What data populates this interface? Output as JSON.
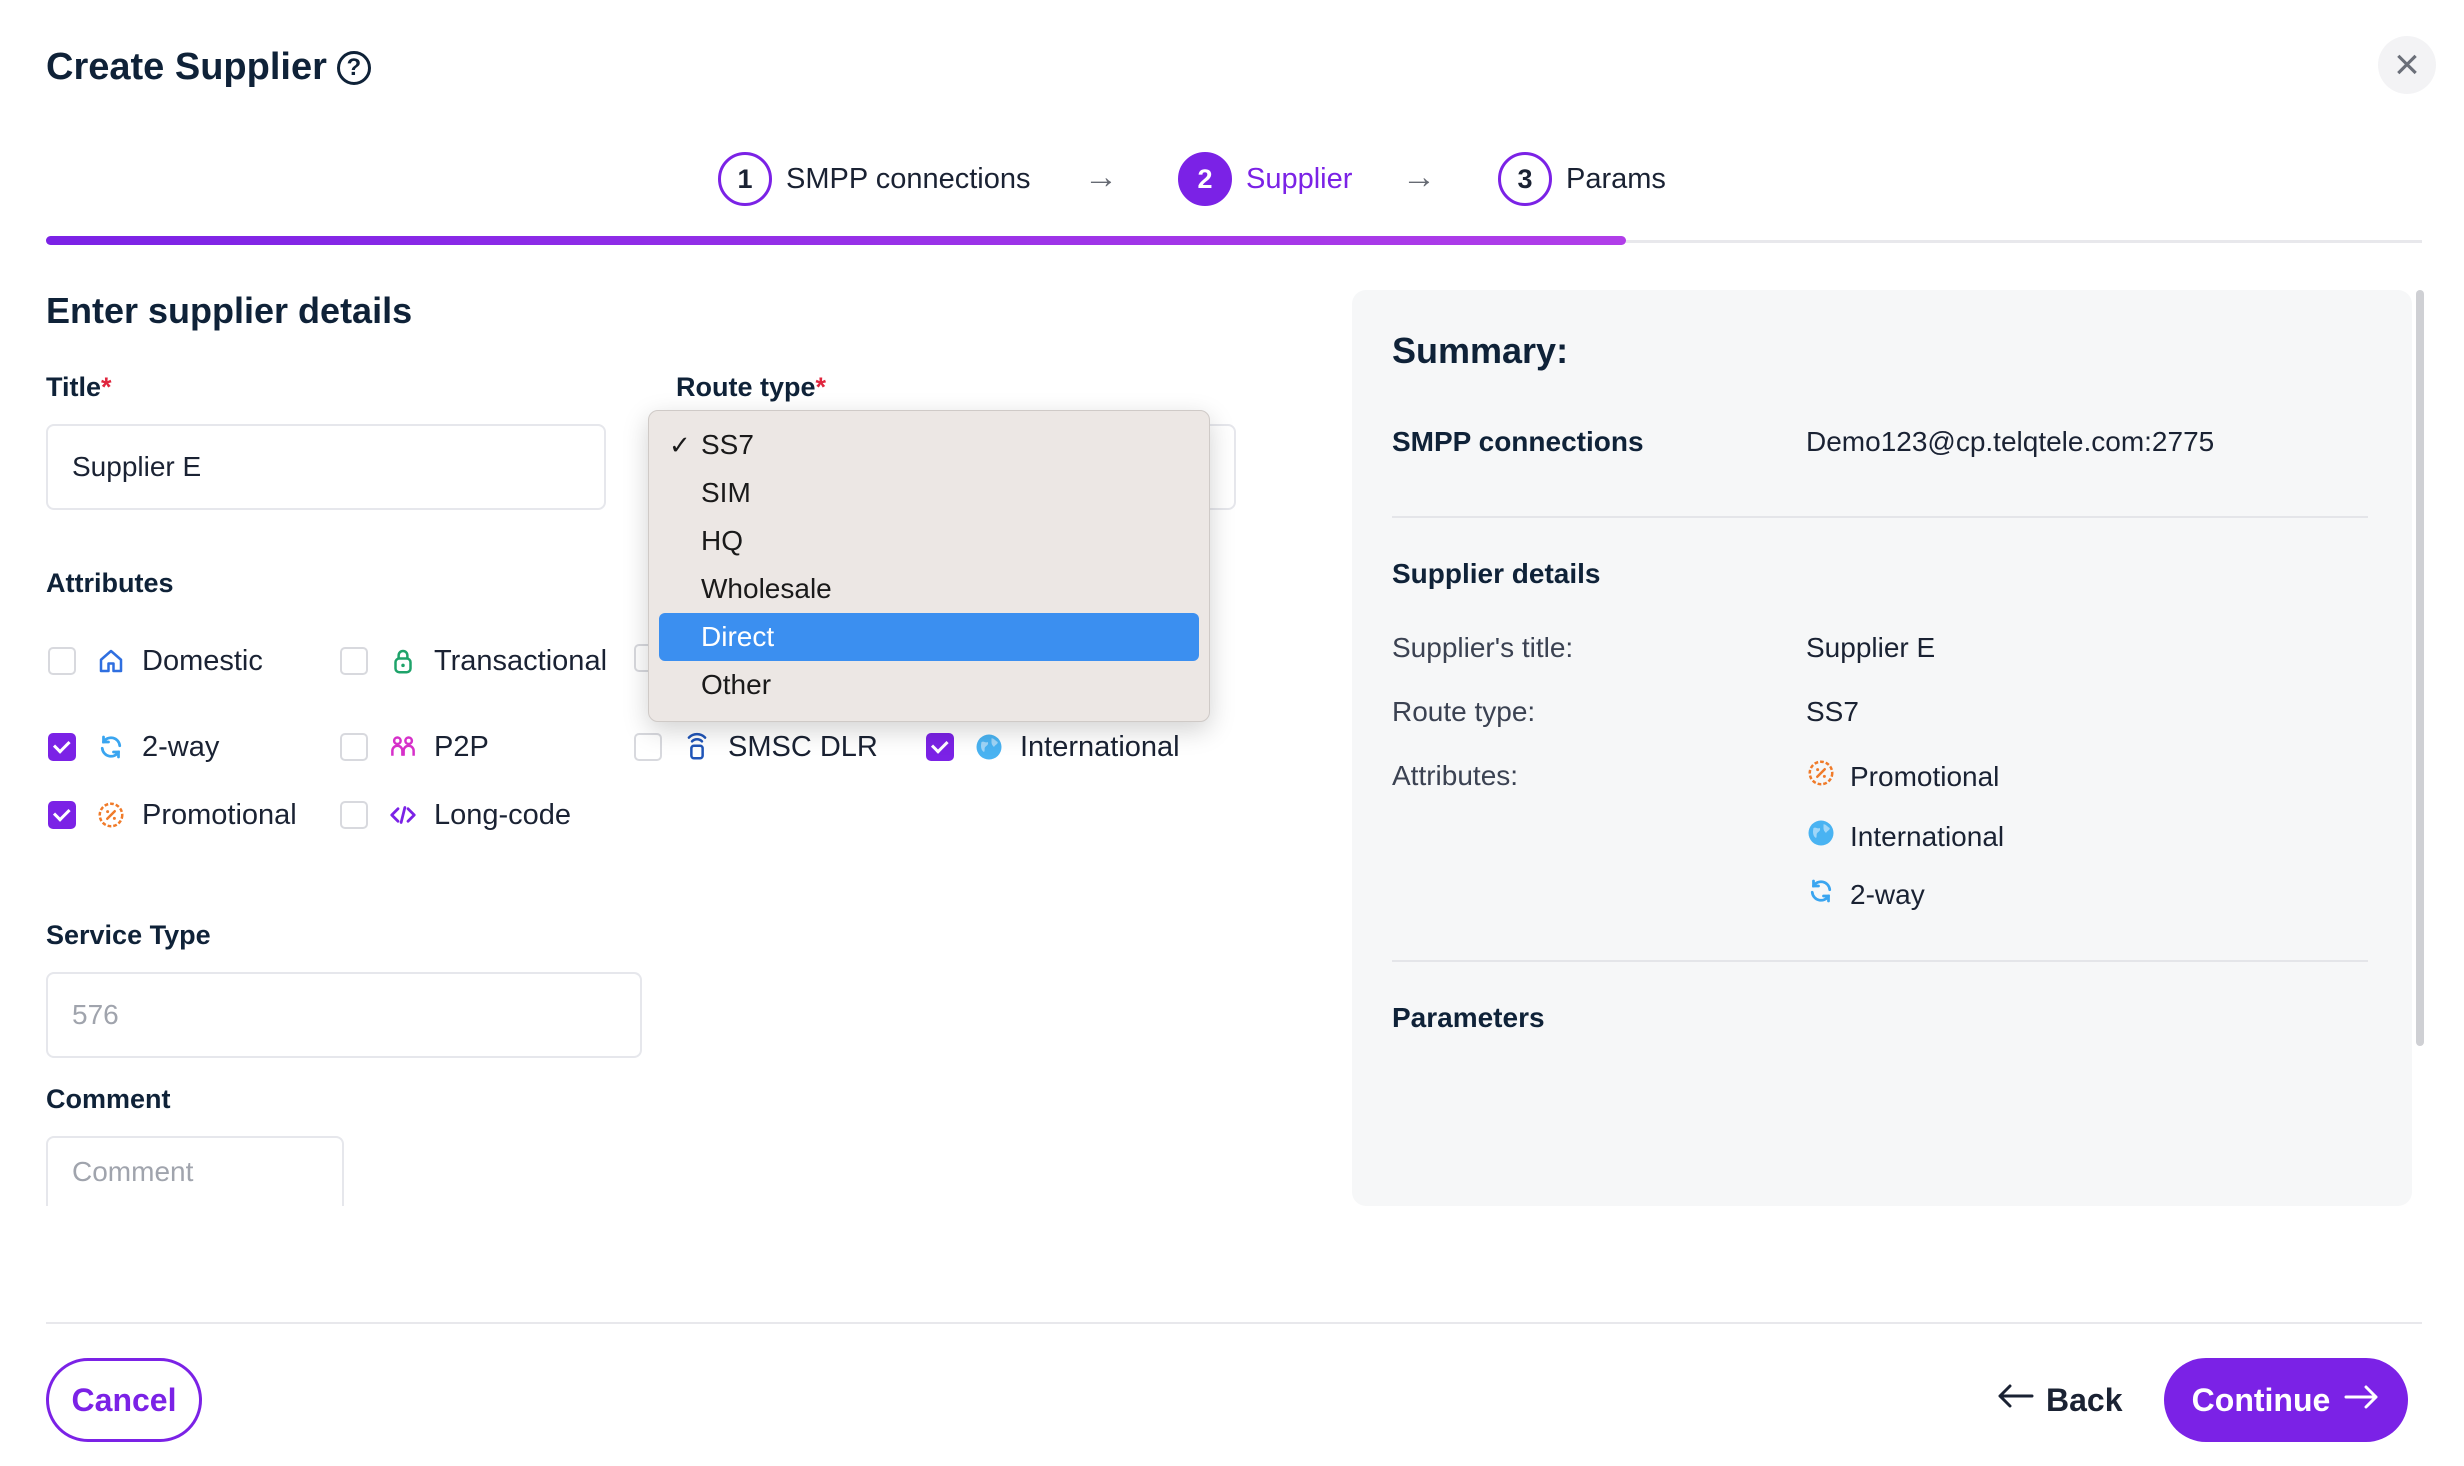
{
  "header": {
    "title": "Create Supplier",
    "help_icon": "question-circle-icon",
    "close_icon": "close-icon"
  },
  "steps": [
    {
      "num": "1",
      "label": "SMPP connections",
      "state": "done"
    },
    {
      "num": "2",
      "label": "Supplier",
      "state": "active"
    },
    {
      "num": "3",
      "label": "Params",
      "state": "pending"
    }
  ],
  "progress": {
    "fraction": 0.665
  },
  "colors": {
    "accent": "#7b22e6",
    "required": "#e0263e",
    "highlight": "#3b8ff0"
  },
  "form": {
    "heading": "Enter supplier details",
    "title_label": "Title",
    "title_value": "Supplier E",
    "route_label": "Route type",
    "required_mark": "*",
    "attributes_label": "Attributes",
    "attributes": [
      {
        "label": "Domestic",
        "checked": false,
        "icon": "home-icon"
      },
      {
        "label": "Transactional",
        "checked": false,
        "icon": "lock-icon"
      },
      {
        "label": "2-way",
        "checked": true,
        "icon": "refresh-icon"
      },
      {
        "label": "P2P",
        "checked": false,
        "icon": "people-icon"
      },
      {
        "label": "SMSC DLR",
        "checked": false,
        "icon": "signal-icon"
      },
      {
        "label": "International",
        "checked": true,
        "icon": "globe-icon"
      },
      {
        "label": "Promotional",
        "checked": true,
        "icon": "discount-icon"
      },
      {
        "label": "Long-code",
        "checked": false,
        "icon": "code-icon"
      }
    ],
    "service_type_label": "Service Type",
    "service_type_placeholder": "576",
    "comment_label": "Comment",
    "comment_placeholder": "Comment"
  },
  "route_dropdown": {
    "options": [
      "SS7",
      "SIM",
      "HQ",
      "Wholesale",
      "Direct",
      "Other"
    ],
    "selected": "SS7",
    "highlighted": "Direct",
    "check_mark": "✓"
  },
  "summary": {
    "title": "Summary:",
    "smpp_label": "SMPP connections",
    "smpp_value": "Demo123@cp.telqtele.com:2775",
    "details_label": "Supplier details",
    "supplier_title_key": "Supplier's title:",
    "supplier_title_value": "Supplier E",
    "route_type_key": "Route type:",
    "route_type_value": "SS7",
    "attributes_key": "Attributes:",
    "attributes": [
      {
        "label": "Promotional",
        "icon": "discount-icon"
      },
      {
        "label": "International",
        "icon": "globe-icon"
      },
      {
        "label": "2-way",
        "icon": "refresh-icon"
      }
    ],
    "parameters_label": "Parameters"
  },
  "footer": {
    "cancel": "Cancel",
    "back": "Back",
    "continue": "Continue"
  }
}
